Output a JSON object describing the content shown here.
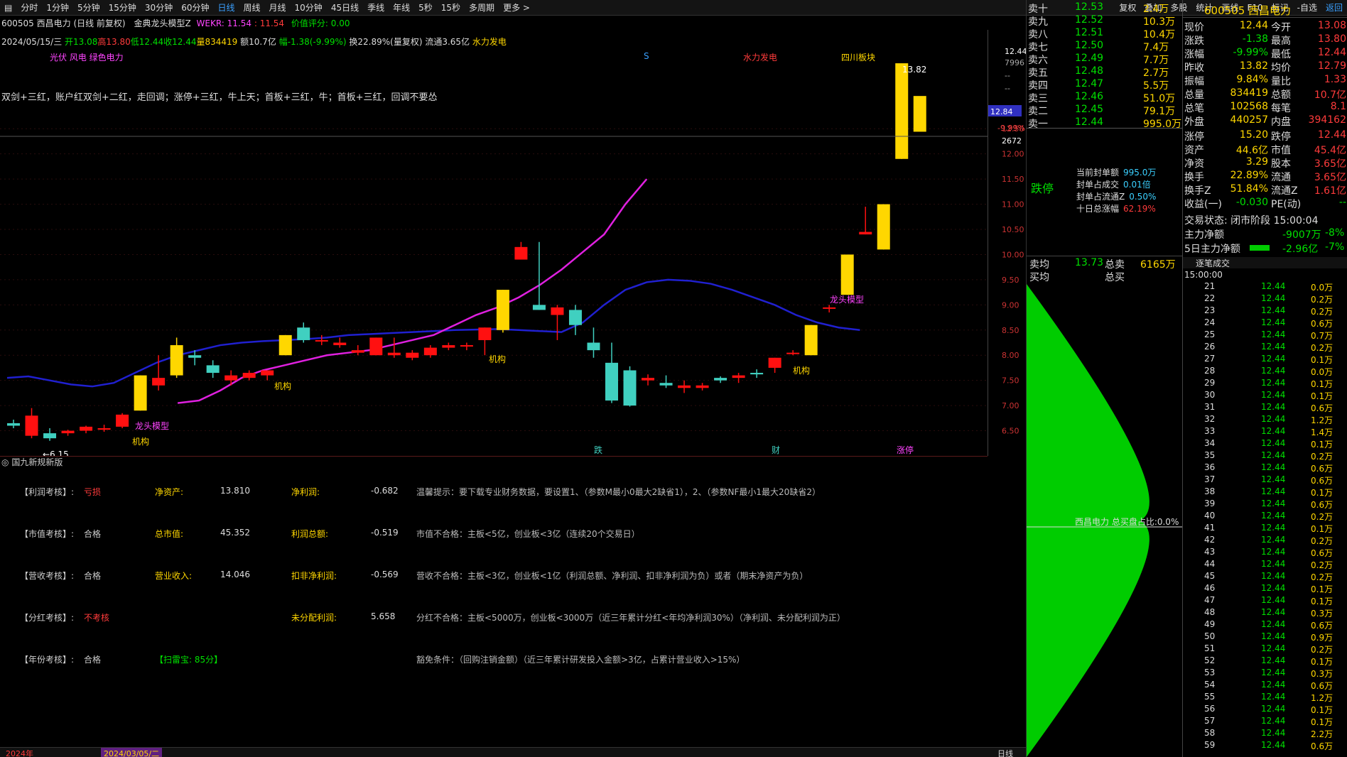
{
  "toolbar": {
    "items": [
      "分时",
      "1分钟",
      "5分钟",
      "15分钟",
      "30分钟",
      "60分钟",
      "日线",
      "周线",
      "月线",
      "10分钟",
      "45日线",
      "季线",
      "年线",
      "5秒",
      "15秒",
      "多周期",
      "更多 >"
    ],
    "right_items": [
      "复权",
      "叠加",
      "多股",
      "统计",
      "画线",
      "F10",
      "标记",
      "-自选",
      "返回"
    ],
    "active": "日线"
  },
  "header": {
    "stock": "600505 西昌电力 (日线 前复权)",
    "indicator": "金典龙头模型Z",
    "wekr_label": "WEKR: 11.54",
    "wekr_val": ": 11.54",
    "score": "价值评分: 0.00"
  },
  "info": {
    "date": "2024/05/15/三",
    "open": "开13.08",
    "high": "高13.80",
    "low": "低12.44",
    "close": "收12.44",
    "vol": "量834419",
    "amt": "额10.7亿",
    "chg": "幅-1.38(-9.99%)",
    "turnover": "换22.89%(量复权)",
    "float": "流通3.65亿",
    "concept": "水力发电"
  },
  "concepts": {
    "left": "光伏 风电 绿色电力",
    "s": "S",
    "water": "水力发电",
    "sichuan": "四川板块"
  },
  "strategy": "双剑+三红，账户红双剑+二红，走回调；涨停+三红，牛上天；首板+三红，牛；首板+三红，回调不要怂",
  "chart_data": {
    "type": "candlestick",
    "candles": [
      [
        6.65,
        6.72,
        6.55,
        6.6
      ],
      [
        6.4,
        6.95,
        6.35,
        6.8
      ],
      [
        6.45,
        6.55,
        6.3,
        6.35
      ],
      [
        6.45,
        6.52,
        6.4,
        6.5
      ],
      [
        6.5,
        6.6,
        6.45,
        6.58
      ],
      [
        6.52,
        6.62,
        6.48,
        6.55
      ],
      [
        6.58,
        6.85,
        6.55,
        6.82
      ],
      [
        6.9,
        7.6,
        6.9,
        7.6
      ],
      [
        7.4,
        8.0,
        7.3,
        7.55
      ],
      [
        7.6,
        8.35,
        7.55,
        8.2
      ],
      [
        8.0,
        8.1,
        7.8,
        7.95
      ],
      [
        7.8,
        7.9,
        7.55,
        7.65
      ],
      [
        7.5,
        7.7,
        7.4,
        7.6
      ],
      [
        7.55,
        7.7,
        7.5,
        7.65
      ],
      [
        7.6,
        7.7,
        7.5,
        7.7
      ],
      [
        8.0,
        8.4,
        8.0,
        8.4
      ],
      [
        8.55,
        8.65,
        8.25,
        8.3
      ],
      [
        8.3,
        8.4,
        8.2,
        8.3
      ],
      [
        8.2,
        8.35,
        8.15,
        8.25
      ],
      [
        8.05,
        8.2,
        8.0,
        8.1
      ],
      [
        8.0,
        8.35,
        8.0,
        8.35
      ],
      [
        8.0,
        8.35,
        7.95,
        8.05
      ],
      [
        7.95,
        8.1,
        7.9,
        8.05
      ],
      [
        8.0,
        8.2,
        7.95,
        8.15
      ],
      [
        8.15,
        8.25,
        8.1,
        8.2
      ],
      [
        8.18,
        8.25,
        8.1,
        8.2
      ],
      [
        8.3,
        8.55,
        8.0,
        8.55
      ],
      [
        8.5,
        9.3,
        8.45,
        9.3
      ],
      [
        9.9,
        10.25,
        9.9,
        10.15
      ],
      [
        9.0,
        10.25,
        8.9,
        8.9
      ],
      [
        8.8,
        9.0,
        8.3,
        8.95
      ],
      [
        8.9,
        9.0,
        8.4,
        8.6
      ],
      [
        8.25,
        8.55,
        7.95,
        8.1
      ],
      [
        7.85,
        8.25,
        7.05,
        7.1
      ],
      [
        7.7,
        7.78,
        6.98,
        7.0
      ],
      [
        7.5,
        7.62,
        7.4,
        7.55
      ],
      [
        7.45,
        7.6,
        7.35,
        7.4
      ],
      [
        7.35,
        7.5,
        7.25,
        7.4
      ],
      [
        7.35,
        7.45,
        7.3,
        7.4
      ],
      [
        7.55,
        7.58,
        7.45,
        7.5
      ],
      [
        7.55,
        7.65,
        7.45,
        7.6
      ],
      [
        7.65,
        7.72,
        7.55,
        7.62
      ],
      [
        7.75,
        7.95,
        7.65,
        7.95
      ],
      [
        8.05,
        8.1,
        8.0,
        8.05
      ],
      [
        8.0,
        8.6,
        8.0,
        8.6
      ],
      [
        8.95,
        9.0,
        8.85,
        8.95
      ],
      [
        9.2,
        10.0,
        9.2,
        10.0
      ],
      [
        10.4,
        10.95,
        10.4,
        10.45
      ],
      [
        10.1,
        11.0,
        10.1,
        11.0
      ],
      [
        11.9,
        12.1,
        11.9,
        13.8
      ],
      [
        12.44,
        13.15,
        13.15,
        13.15
      ]
    ],
    "ma_blue": [
      7.55,
      7.58,
      7.5,
      7.42,
      7.38,
      7.45,
      7.65,
      7.85,
      8.0,
      8.1,
      8.2,
      8.25,
      8.28,
      8.3,
      8.32,
      8.35,
      8.4,
      8.42,
      8.44,
      8.46,
      8.48,
      8.5,
      8.51,
      8.52,
      8.5,
      8.48,
      8.46,
      8.65,
      9.0,
      9.3,
      9.45,
      9.5,
      9.48,
      9.42,
      9.3,
      9.15,
      9.0,
      8.8,
      8.65,
      8.55,
      8.5
    ],
    "ma_pink": [
      7.05,
      7.1,
      7.3,
      7.55,
      7.7,
      7.8,
      7.9,
      8.0,
      8.05,
      8.1,
      8.2,
      8.3,
      8.4,
      8.6,
      8.8,
      8.95,
      9.15,
      9.4,
      9.7,
      10.05,
      10.4,
      11.0,
      11.5
    ],
    "ylabels": [
      "12.50",
      "12.00",
      "11.50",
      "11.00",
      "10.50",
      "10.00",
      "9.50",
      "9.00",
      "8.50",
      "8.00",
      "7.50",
      "7.00",
      "6.50"
    ],
    "price_scale_top": [
      "12.44",
      "7996",
      "--",
      "--",
      "12.84",
      "-9.99%",
      "2672"
    ],
    "annotations": {
      "jigou1": "机构",
      "jigou2": "机构",
      "jigou3": "机构",
      "jigou4": "机构",
      "longtou1": "龙头模型",
      "longtou2": "龙头模型",
      "low": "6.15",
      "high": "13.82"
    },
    "bottom_tags": [
      "跌",
      "财",
      "涨停"
    ]
  },
  "sub": {
    "title": "国九新规新版",
    "rows": [
      [
        "【利润考核】:",
        "亏损",
        "净资产:",
        "13.810",
        "净利润:",
        "-0.682",
        "温馨提示：要下载专业财务数据，要设置1、（参数M最小0最大2缺省1），2、（参数NF最小1最大20缺省2）"
      ],
      [
        "【市值考核】:",
        "合格",
        "总市值:",
        "45.352",
        "利润总额:",
        "-0.519",
        "市值不合格：主板<5亿，创业板<3亿（连续20个交易日）"
      ],
      [
        "【营收考核】:",
        "合格",
        "营业收入:",
        "14.046",
        "扣非净利润:",
        "-0.569",
        "营收不合格：主板<3亿，创业板<1亿（利润总额、净利润、扣非净利润为负）或者（期末净资产为负）"
      ],
      [
        "【分红考核】:",
        "不考核",
        "",
        "",
        "未分配利润:",
        "5.658",
        "分红不合格：主板<5000万，创业板<3000万（近三年累计分红<年均净利润30%）（净利润、未分配利润为正）"
      ],
      [
        "【年份考核】:",
        "合格",
        "【扫雷宝: 85分】",
        "",
        "",
        "",
        "豁免条件：（回购注销金额）（近三年累计研发投入金额>3亿，占累计营业收入>15%）"
      ]
    ]
  },
  "bottom_bar": {
    "left": "2024年",
    "mid": "2024/03/05/二",
    "right": "日线"
  },
  "orderbook": [
    [
      "卖十",
      "12.53",
      "2.4万"
    ],
    [
      "卖九",
      "12.52",
      "10.3万"
    ],
    [
      "卖八",
      "12.51",
      "10.4万"
    ],
    [
      "卖七",
      "12.50",
      "7.4万"
    ],
    [
      "卖六",
      "12.49",
      "7.7万"
    ],
    [
      "卖五",
      "12.48",
      "2.7万"
    ],
    [
      "卖四",
      "12.47",
      "5.5万"
    ],
    [
      "卖三",
      "12.46",
      "51.0万"
    ],
    [
      "卖二",
      "12.45",
      "79.1万"
    ],
    [
      "卖一",
      "12.44",
      "995.0万"
    ]
  ],
  "limit": {
    "label": "跌停",
    "rows": [
      [
        "当前封单额",
        "995.0万"
      ],
      [
        "封单占成交",
        "0.01倍"
      ],
      [
        "封单占流通Z",
        "0.50%"
      ],
      [
        "十日总涨幅",
        "62.19%"
      ]
    ]
  },
  "avg": {
    "sell_avg_label": "卖均",
    "sell_avg": "13.73",
    "total_sell_label": "总卖",
    "total_sell": "6165万",
    "buy_avg_label": "买均",
    "total_buy_label": "总买"
  },
  "funnel": {
    "label": "西昌电力 总买盘占比:0.0%"
  },
  "quote": {
    "title": "600505 西昌电力",
    "rows": [
      [
        "现价",
        "12.44",
        "今开",
        "13.08"
      ],
      [
        "涨跌",
        "-1.38",
        "最高",
        "13.80"
      ],
      [
        "涨幅",
        "-9.99%",
        "最低",
        "12.44"
      ],
      [
        "昨收",
        "13.82",
        "均价",
        "12.79"
      ],
      [
        "振幅",
        "9.84%",
        "量比",
        "1.33"
      ],
      [
        "总量",
        "834419",
        "总额",
        "10.7亿"
      ],
      [
        "总笔",
        "102568",
        "每笔",
        "8.1"
      ],
      [
        "外盘",
        "440257",
        "内盘",
        "394162"
      ]
    ],
    "rows2": [
      [
        "涨停",
        "15.20",
        "跌停",
        "12.44"
      ],
      [
        "资产",
        "44.6亿",
        "市值",
        "45.4亿"
      ],
      [
        "净资",
        "3.29",
        "股本",
        "3.65亿"
      ],
      [
        "换手",
        "22.89%",
        "流通",
        "3.65亿"
      ],
      [
        "换手Z",
        "51.84%",
        "流通Z",
        "1.61亿"
      ],
      [
        "收益(一)",
        "-0.030",
        "PE(动)",
        "--"
      ]
    ],
    "status": "交易状态: 闭市阶段 15:00:04",
    "main_net": [
      "主力净额",
      "-9007万",
      "-8%"
    ],
    "main_net5": [
      "5日主力净额",
      "-2.96亿",
      "-7%"
    ],
    "ticks_title": "逐笔成交",
    "ticks_first": "15:00:00",
    "ticks": [
      [
        "21",
        "12.44",
        "0.0万"
      ],
      [
        "22",
        "12.44",
        "0.2万"
      ],
      [
        "23",
        "12.44",
        "0.2万"
      ],
      [
        "24",
        "12.44",
        "0.6万"
      ],
      [
        "25",
        "12.44",
        "0.7万"
      ],
      [
        "26",
        "12.44",
        "0.2万"
      ],
      [
        "27",
        "12.44",
        "0.1万"
      ],
      [
        "28",
        "12.44",
        "0.0万"
      ],
      [
        "29",
        "12.44",
        "0.1万"
      ],
      [
        "30",
        "12.44",
        "0.1万"
      ],
      [
        "31",
        "12.44",
        "0.6万"
      ],
      [
        "32",
        "12.44",
        "1.2万"
      ],
      [
        "33",
        "12.44",
        "1.4万"
      ],
      [
        "34",
        "12.44",
        "0.1万"
      ],
      [
        "35",
        "12.44",
        "0.2万"
      ],
      [
        "36",
        "12.44",
        "0.6万"
      ],
      [
        "37",
        "12.44",
        "0.6万"
      ],
      [
        "38",
        "12.44",
        "0.1万"
      ],
      [
        "39",
        "12.44",
        "0.6万"
      ],
      [
        "40",
        "12.44",
        "0.2万"
      ],
      [
        "41",
        "12.44",
        "0.1万"
      ],
      [
        "42",
        "12.44",
        "0.2万"
      ],
      [
        "43",
        "12.44",
        "0.6万"
      ],
      [
        "44",
        "12.44",
        "0.2万"
      ],
      [
        "45",
        "12.44",
        "0.2万"
      ],
      [
        "46",
        "12.44",
        "0.1万"
      ],
      [
        "47",
        "12.44",
        "0.1万"
      ],
      [
        "48",
        "12.44",
        "0.3万"
      ],
      [
        "49",
        "12.44",
        "0.6万"
      ],
      [
        "50",
        "12.44",
        "0.9万"
      ],
      [
        "51",
        "12.44",
        "0.2万"
      ],
      [
        "52",
        "12.44",
        "0.1万"
      ],
      [
        "53",
        "12.44",
        "0.3万"
      ],
      [
        "54",
        "12.44",
        "0.6万"
      ],
      [
        "55",
        "12.44",
        "1.2万"
      ],
      [
        "56",
        "12.44",
        "0.1万"
      ],
      [
        "57",
        "12.44",
        "0.1万"
      ],
      [
        "58",
        "12.44",
        "2.2万"
      ],
      [
        "59",
        "12.44",
        "0.6万"
      ]
    ]
  }
}
